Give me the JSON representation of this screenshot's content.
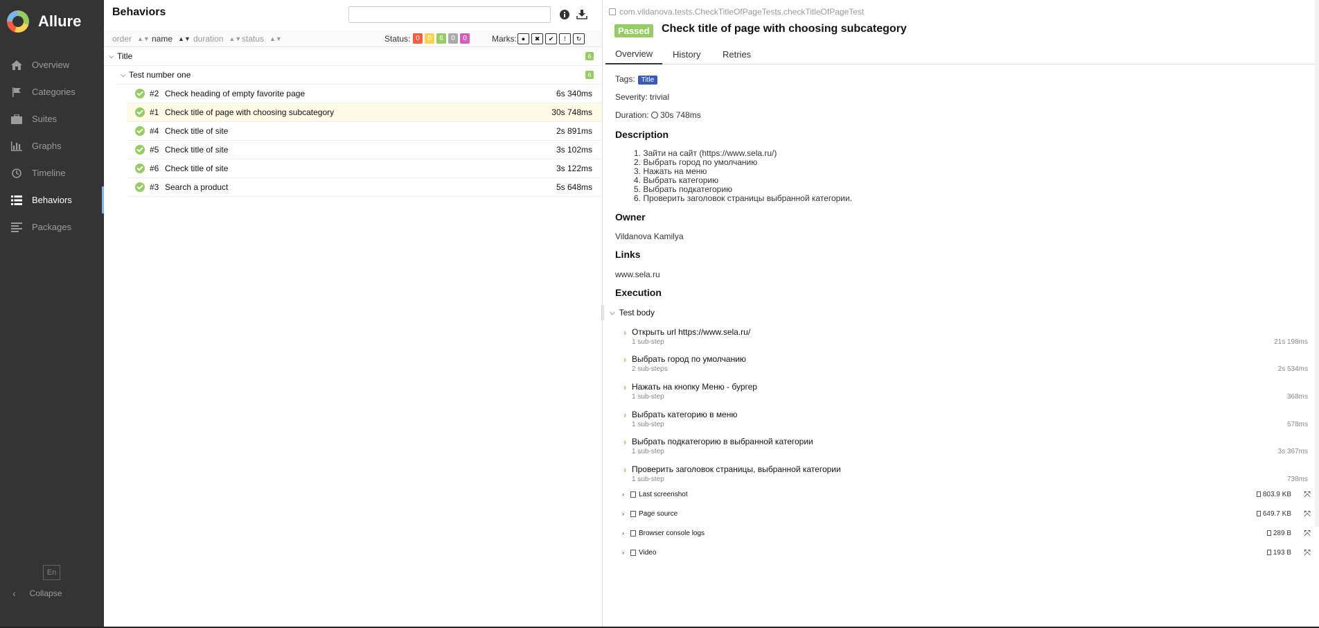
{
  "brand": {
    "name": "Allure"
  },
  "sidebar": {
    "items": [
      {
        "label": "Overview",
        "icon": "home-icon"
      },
      {
        "label": "Categories",
        "icon": "flag-icon"
      },
      {
        "label": "Suites",
        "icon": "briefcase-icon"
      },
      {
        "label": "Graphs",
        "icon": "bar-chart-icon"
      },
      {
        "label": "Timeline",
        "icon": "clock-icon"
      },
      {
        "label": "Behaviors",
        "icon": "list-icon",
        "active": true
      },
      {
        "label": "Packages",
        "icon": "align-left-icon"
      }
    ],
    "lang": "En",
    "collapse": "Collapse"
  },
  "tree": {
    "title": "Behaviors",
    "sort": {
      "order": "order",
      "name": "name",
      "duration": "duration",
      "status": "status"
    },
    "status_label": "Status:",
    "counters": [
      {
        "value": "0",
        "color": "#fd5a3e"
      },
      {
        "value": "0",
        "color": "#ffd050"
      },
      {
        "value": "6",
        "color": "#97cc64"
      },
      {
        "value": "0",
        "color": "#aaaaaa"
      },
      {
        "value": "0",
        "color": "#d35ebe"
      }
    ],
    "marks_label": "Marks:",
    "groups": [
      {
        "name": "Title",
        "count": "6"
      },
      {
        "name": "Test number one",
        "count": "6"
      }
    ],
    "cases": [
      {
        "num": "#2",
        "name": "Check heading of empty favorite page",
        "duration": "6s 340ms",
        "selected": false
      },
      {
        "num": "#1",
        "name": "Check title of page with choosing subcategory",
        "duration": "30s 748ms",
        "selected": true
      },
      {
        "num": "#4",
        "name": "Check title of site",
        "duration": "2s 891ms",
        "selected": false
      },
      {
        "num": "#5",
        "name": "Check title of site",
        "duration": "3s 102ms",
        "selected": false
      },
      {
        "num": "#6",
        "name": "Check title of site",
        "duration": "3s 122ms",
        "selected": false
      },
      {
        "num": "#3",
        "name": "Search a product",
        "duration": "5s 648ms",
        "selected": false
      }
    ]
  },
  "detail": {
    "fullname": "com.vildanova.tests.CheckTitleOfPageTests.checkTitleOfPageTest",
    "status": "Passed",
    "title": "Check title of page with choosing subcategory",
    "tabs": [
      "Overview",
      "History",
      "Retries"
    ],
    "tags_label": "Tags:",
    "tag": "Title",
    "severity": "Severity: trivial",
    "duration_label": "Duration:",
    "duration": "30s 748ms",
    "description_heading": "Description",
    "description": [
      "1. Зайти на сайт (https://www.sela.ru/)",
      "2. Выбрать город по умолчанию",
      "3. Нажать на меню",
      "4. Выбрать категорию",
      "5. Выбрать подкатегорию",
      "6. Проверить заголовок страницы выбранной категории."
    ],
    "owner_heading": "Owner",
    "owner": "Vildanova Kamilya",
    "links_heading": "Links",
    "link": "www.sela.ru",
    "execution_heading": "Execution",
    "test_body": "Test body",
    "steps": [
      {
        "name": "Открыть url https://www.sela.ru/",
        "sub": "1 sub-step",
        "duration": "21s 198ms"
      },
      {
        "name": "Выбрать город по умолчанию",
        "sub": "2 sub-steps",
        "duration": "2s 534ms"
      },
      {
        "name": "Нажать на кнопку Меню - бургер",
        "sub": "1 sub-step",
        "duration": "368ms"
      },
      {
        "name": "Выбрать категорию в меню",
        "sub": "1 sub-step",
        "duration": "578ms"
      },
      {
        "name": "Выбрать подкатегорию в выбранной категории",
        "sub": "1 sub-step",
        "duration": "3s 367ms"
      },
      {
        "name": "Проверить заголовок страницы, выбранной категории",
        "sub": "1 sub-step",
        "duration": "738ms"
      }
    ],
    "attachments": [
      {
        "name": "Last screenshot",
        "size": "803.9 KB"
      },
      {
        "name": "Page source",
        "size": "649.7 KB"
      },
      {
        "name": "Browser console logs",
        "size": "289 B"
      },
      {
        "name": "Video",
        "size": "193 B"
      }
    ]
  }
}
